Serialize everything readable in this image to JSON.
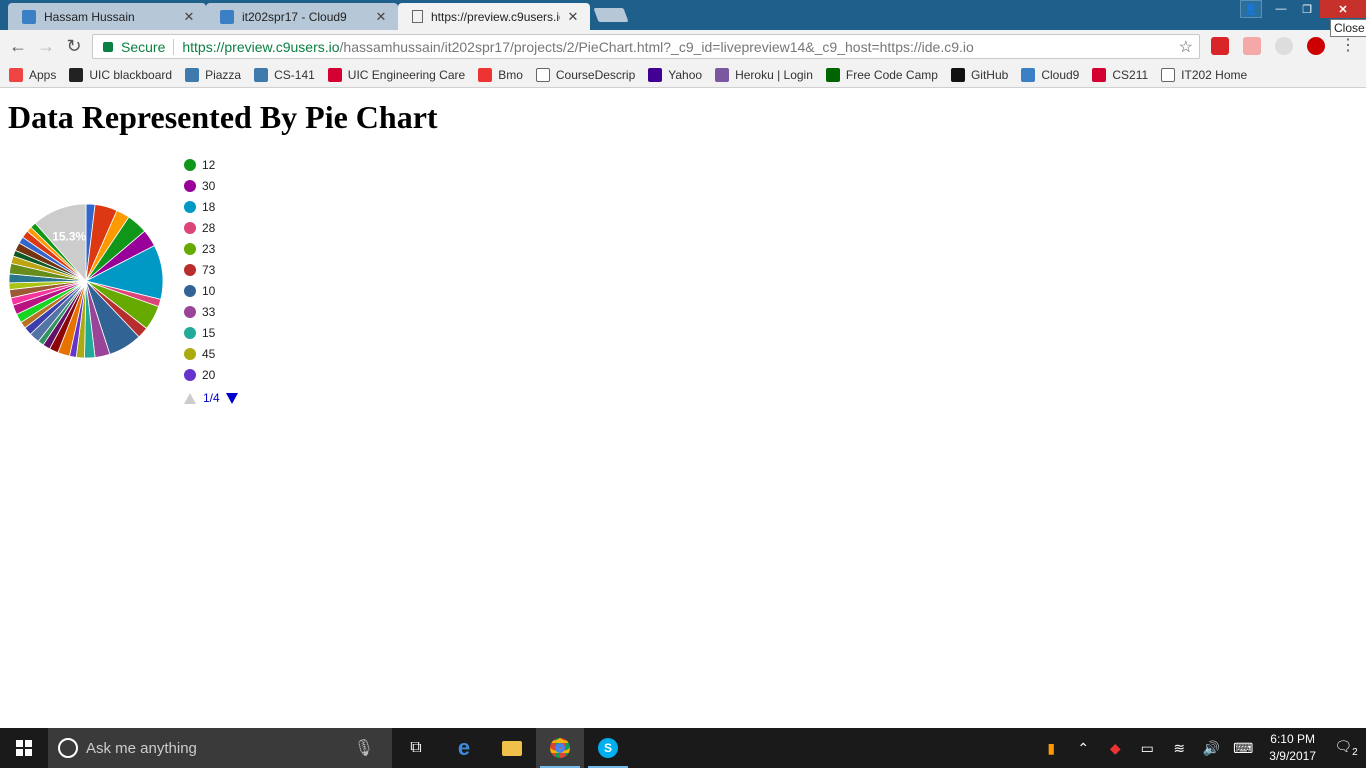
{
  "browser": {
    "tabs": [
      {
        "title": "Hassam Hussain",
        "active": false,
        "icon": "cloud9-icon"
      },
      {
        "title": "it202spr17 - Cloud9",
        "active": false,
        "icon": "cloud9-icon"
      },
      {
        "title": "https://preview.c9users.io",
        "active": true,
        "icon": "document-icon"
      }
    ],
    "close_tooltip": "Close",
    "secure_label": "Secure",
    "url_scheme_host": "https://preview.c9users.io",
    "url_path": "/hassamhussain/it202spr17/projects/2/PieChart.html?_c9_id=livepreview14&_c9_host=https://ide.c9.io",
    "bookmarks": [
      {
        "label": "Apps",
        "icon": "apps-grid-icon",
        "color": "#e44"
      },
      {
        "label": "UIC blackboard",
        "icon": "blackboard-icon",
        "color": "#222"
      },
      {
        "label": "Piazza",
        "icon": "piazza-icon",
        "color": "#3e7aab"
      },
      {
        "label": "CS-141",
        "icon": "grid-icon",
        "color": "#3e7aab"
      },
      {
        "label": "UIC Engineering Care",
        "icon": "uic-icon",
        "color": "#d50032"
      },
      {
        "label": "Bmo",
        "icon": "bmo-icon",
        "color": "#e33"
      },
      {
        "label": "CourseDescrip",
        "icon": "document-icon",
        "color": "#fff"
      },
      {
        "label": "Yahoo",
        "icon": "yahoo-icon",
        "color": "#410093"
      },
      {
        "label": "Heroku | Login",
        "icon": "heroku-icon",
        "color": "#79589f"
      },
      {
        "label": "Free Code Camp",
        "icon": "freecodecamp-icon",
        "color": "#006400"
      },
      {
        "label": "GitHub",
        "icon": "github-icon",
        "color": "#111"
      },
      {
        "label": "Cloud9",
        "icon": "cloud9-icon",
        "color": "#3b7fc4"
      },
      {
        "label": "CS211",
        "icon": "uic-icon",
        "color": "#d50032"
      },
      {
        "label": "IT202 Home",
        "icon": "document-icon",
        "color": "#fff"
      }
    ]
  },
  "page": {
    "heading": "Data Represented By Pie Chart",
    "pager_label": "1/4"
  },
  "chart_data": {
    "type": "pie",
    "highlight_label": "15.3%",
    "legend_values": [
      "12",
      "30",
      "18",
      "28",
      "23",
      "73",
      "10",
      "33",
      "15",
      "45",
      "20"
    ],
    "legend_colors": [
      "#109618",
      "#990099",
      "#0099c6",
      "#dd4477",
      "#66aa00",
      "#b82e2e",
      "#316395",
      "#994499",
      "#22aa99",
      "#aaaa11",
      "#6633cc"
    ],
    "values": [
      12,
      30,
      18,
      28,
      23,
      73,
      10,
      33,
      15,
      45,
      20,
      14,
      11,
      9,
      16,
      12,
      10,
      8,
      14,
      11,
      9,
      12,
      13,
      10,
      11,
      9,
      12,
      14,
      10,
      8,
      11,
      9,
      10,
      7,
      8,
      73
    ],
    "colors": [
      "#3366cc",
      "#dc3912",
      "#ff9900",
      "#109618",
      "#990099",
      "#0099c6",
      "#dd4477",
      "#66aa00",
      "#b82e2e",
      "#316395",
      "#994499",
      "#22aa99",
      "#aaaa11",
      "#6633cc",
      "#e67300",
      "#8b0707",
      "#651067",
      "#329262",
      "#5574a6",
      "#3b3eac",
      "#b77322",
      "#16d620",
      "#b91383",
      "#f4359e",
      "#9c5935",
      "#a9c413",
      "#2a778d",
      "#668d1c",
      "#bea413",
      "#0c5922",
      "#743411",
      "#3366cc",
      "#dc3912",
      "#ff9900",
      "#109618",
      "#cccccc"
    ]
  },
  "taskbar": {
    "search_placeholder": "Ask me anything",
    "time": "6:10 PM",
    "date": "3/9/2017",
    "notifications": "2"
  }
}
